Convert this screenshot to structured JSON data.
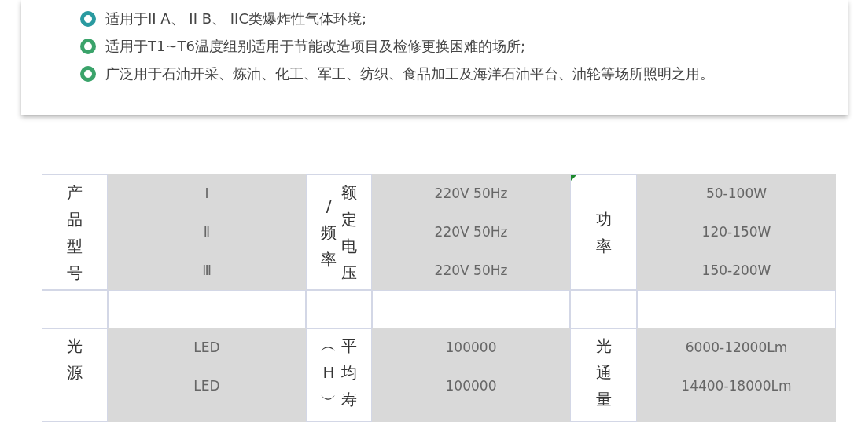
{
  "features": [
    {
      "text": "适用于II A、 II B、 IIC类爆炸性气体环境;",
      "color": "#2a9aa0"
    },
    {
      "text": "适用于T1~T6温度组别适用于节能改造项目及检修更换困难的场所;",
      "color": "#3aa36a"
    },
    {
      "text": "广泛用于石油开采、炼油、化工、军工、纺织、食品加工及海洋石油平台、油轮等场所照明之用。",
      "color": "#3aa36a"
    }
  ],
  "table": {
    "rows": [
      {
        "cells": [
          {
            "kind": "label",
            "columns": [
              "产品型号"
            ]
          },
          {
            "kind": "values",
            "lines": [
              "Ⅰ",
              "Ⅱ",
              "Ⅲ"
            ]
          },
          {
            "kind": "label",
            "columns": [
              "额定电压",
              "/频率"
            ]
          },
          {
            "kind": "values",
            "lines": [
              "220V 50Hz",
              "220V 50Hz",
              "220V 50Hz"
            ]
          },
          {
            "kind": "label",
            "columns": [
              "功率"
            ],
            "corner_mark": true
          },
          {
            "kind": "values",
            "lines": [
              "50-100W",
              "120-150W",
              "150-200W"
            ]
          }
        ]
      },
      {
        "cells": [
          {
            "kind": "blank"
          },
          {
            "kind": "blank"
          },
          {
            "kind": "blank"
          },
          {
            "kind": "blank"
          },
          {
            "kind": "blank"
          },
          {
            "kind": "blank"
          }
        ]
      },
      {
        "cells": [
          {
            "kind": "label",
            "columns": [
              "光源"
            ]
          },
          {
            "kind": "values",
            "lines": [
              "LED",
              "LED"
            ]
          },
          {
            "kind": "label",
            "columns": [
              "平均寿",
              "︵H︶"
            ]
          },
          {
            "kind": "values",
            "lines": [
              "100000",
              "100000"
            ]
          },
          {
            "kind": "label",
            "columns": [
              "光通量"
            ]
          },
          {
            "kind": "values",
            "lines": [
              "6000-12000Lm",
              "14400-18000Lm"
            ]
          }
        ]
      }
    ]
  }
}
